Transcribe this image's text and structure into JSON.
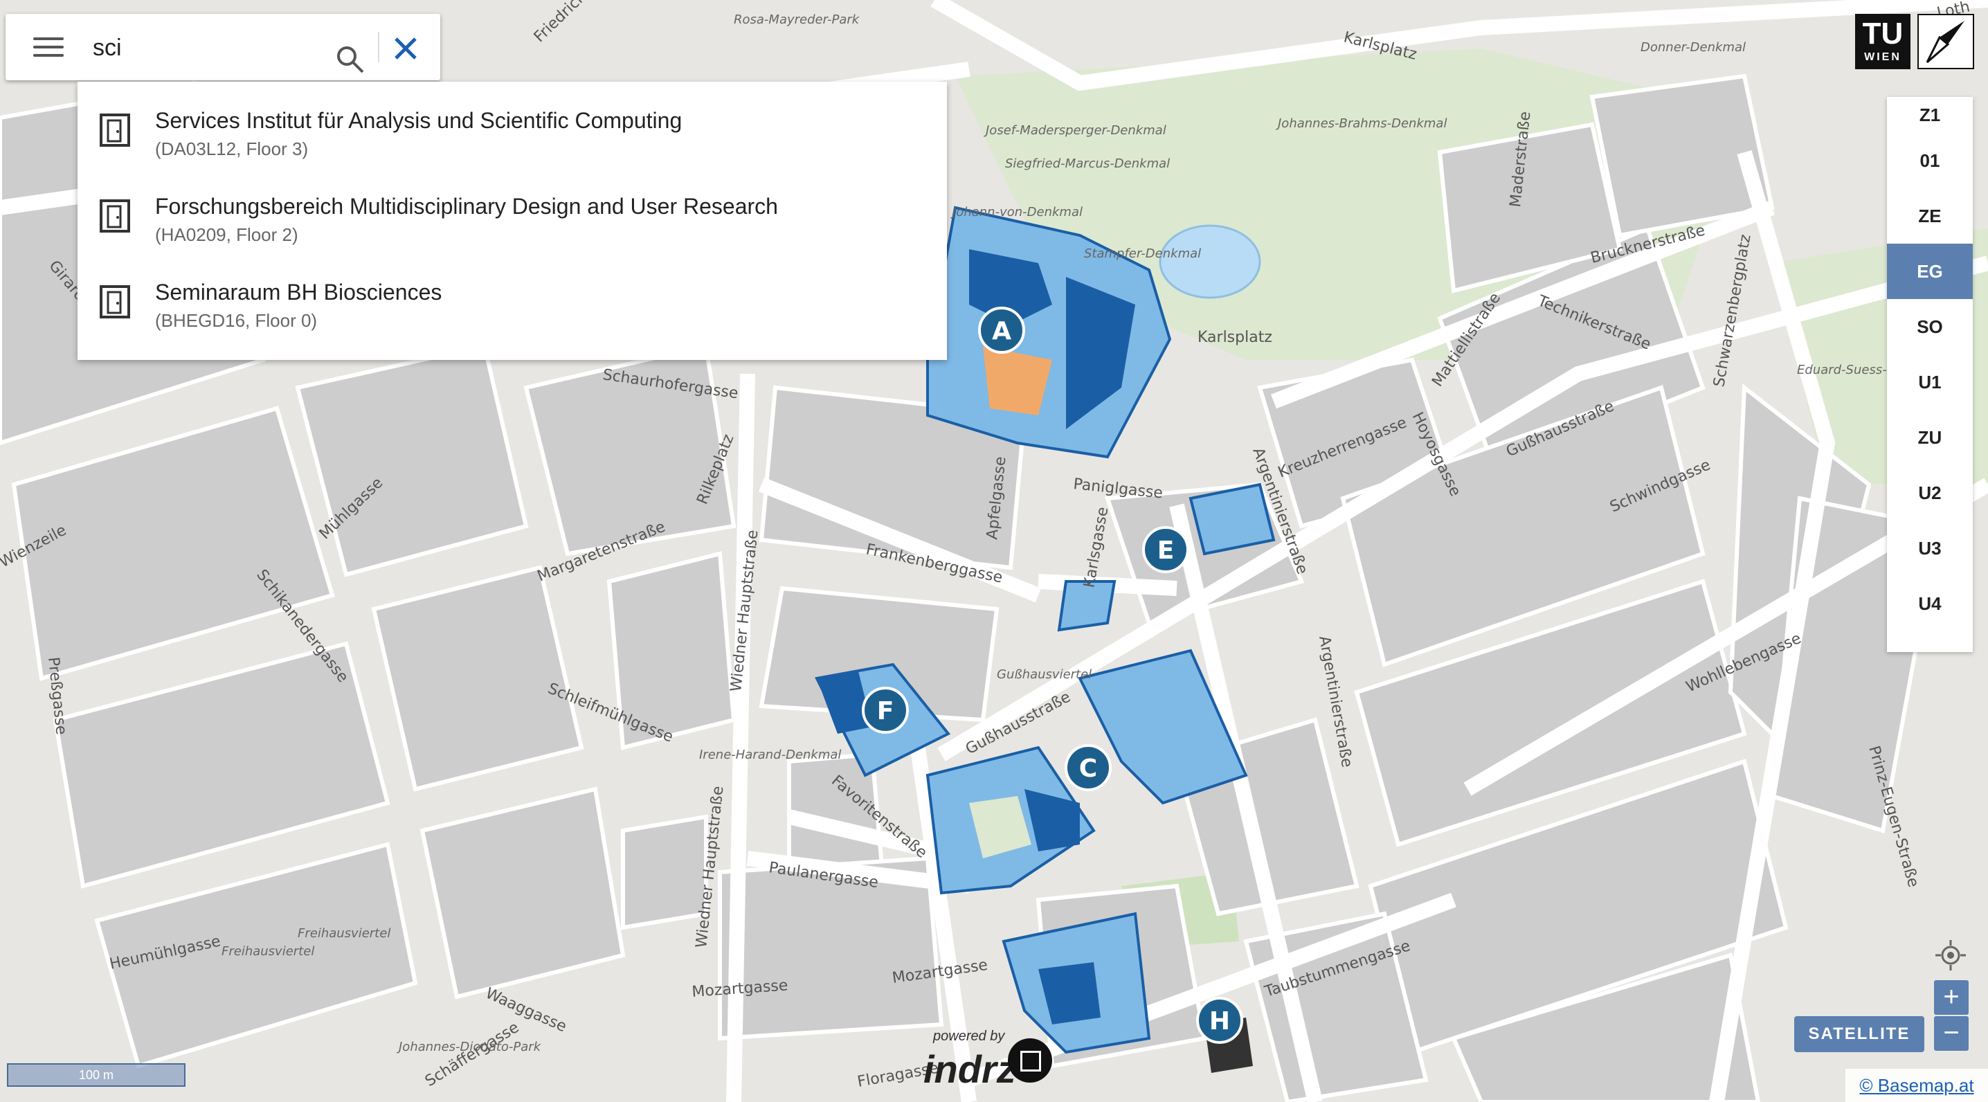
{
  "search": {
    "query": "sci",
    "menu_icon": "hamburger-menu-icon",
    "search_icon": "magnifier-icon",
    "clear_icon": "close-x-icon"
  },
  "results": [
    {
      "title": "Services Institut für Analysis und Scientific Computing",
      "subtitle": "(DA03L12, Floor 3)",
      "icon": "room-icon"
    },
    {
      "title": "Forschungsbereich Multidisciplinary Design and User Research",
      "subtitle": "(HA0209, Floor 2)",
      "icon": "room-icon"
    },
    {
      "title": "Seminaraum BH Biosciences",
      "subtitle": "(BHEGD16, Floor 0)",
      "icon": "room-icon"
    }
  ],
  "logo": {
    "line1": "TU",
    "line2": "WIEN"
  },
  "floors": {
    "items": [
      "Z1",
      "01",
      "ZE",
      "EG",
      "SO",
      "U1",
      "ZU",
      "U2",
      "U3",
      "U4"
    ],
    "active": "EG"
  },
  "controls": {
    "zoom_in": "+",
    "zoom_out": "−",
    "satellite": "SATELLITE",
    "scale": "100 m",
    "attribution": "© Basemap.at"
  },
  "indrz": {
    "powered_by": "powered by",
    "name": "indrz"
  },
  "markers": [
    "A",
    "C",
    "E",
    "F",
    "H"
  ],
  "streets": {
    "karlsplatz": "Karlsplatz",
    "karlsplatz_park": "Karlsplatz",
    "paniglgasse": "Paniglgasse",
    "frankenberggasse": "Frankenberggasse",
    "margaretenstrasse": "Margaretenstraße",
    "wiedner_hauptstrasse": "Wiedner Hauptstraße",
    "schleifmuehlgasse": "Schleifmühlgasse",
    "gusshausstrasse": "Gußhausstraße",
    "gusshausstrasse2": "Gußhausstraße",
    "gusshausviertel": "Gußhausviertel",
    "favoritenstrasse": "Favoritenstraße",
    "paulanergasse": "Paulanergasse",
    "argentinierstrasse": "Argentinierstraße",
    "argentinierstrasse2": "Argentinierstraße",
    "kreuzherrengasse": "Kreuzherrengasse",
    "schwindgasse": "Schwindgasse",
    "wohllebengasse": "Wohllebengasse",
    "prinz_eugen": "Prinz-Eugen-Straße",
    "schwarzenbergplatz": "Schwarzenbergplatz",
    "technikerstrasse": "Technikerstraße",
    "bruckner": "Brucknerstraße",
    "maderstrasse": "Maderstraße",
    "mattiellistrasse": "Mattiellistraße",
    "hoyosgasse": "Hoyosgasse",
    "rilkeplatz": "Rilkeplatz",
    "muehlgasse": "Mühlgasse",
    "schikanedergasse": "Schikanedergasse",
    "pressgasse": "Preßgasse",
    "mozartgasse": "Mozartgasse",
    "waaggasse": "Waaggasse",
    "heumuehlgasse": "Heumühlgasse",
    "freihausviertel": "Freihausviertel",
    "freihausviertel2": "Freihausviertel",
    "floragasse": "Floragasse",
    "taubstummengasse": "Taubstummengasse",
    "karlsgasse": "Karlsgasse",
    "apfelgasse": "Apfelgasse",
    "wienzeile": "Wienzeile",
    "mozartplatz": "Mozartgasse",
    "schaeffergasse": "Schäffergasse",
    "girardigasse": "Girardigasse",
    "friedrichstrasse": "Friedrichstraße",
    "schaurhofergasse": "Schaurhofergasse",
    "lothringer": "Loth"
  },
  "pois": {
    "rosa_mayreder": "Rosa-Mayreder-Park",
    "donner": "Donner-Denkmal",
    "josef": "Josef-Madersperger-Denkmal",
    "johannes": "Johannes-Brahms-Denkmal",
    "siegfried": "Siegfried-Marcus-Denkmal",
    "johann": "Johann-von-Denkmal",
    "stampfer": "Stampfer-Denkmal",
    "eduard": "Eduard-Suess-Denkmal",
    "irene": "Irene-Harand-Denkmal",
    "johannes_diodato": "Johannes-Diodato-Park"
  },
  "colors": {
    "accent": "#5b7fae",
    "marker": "#1d5f8c",
    "building_dark": "#1a5fa6",
    "building_light": "#7fb9e6",
    "map_bg": "#e6e4e0",
    "block": "#cfcfcf",
    "park": "#dde8d0",
    "water": "#b8dcf5"
  }
}
